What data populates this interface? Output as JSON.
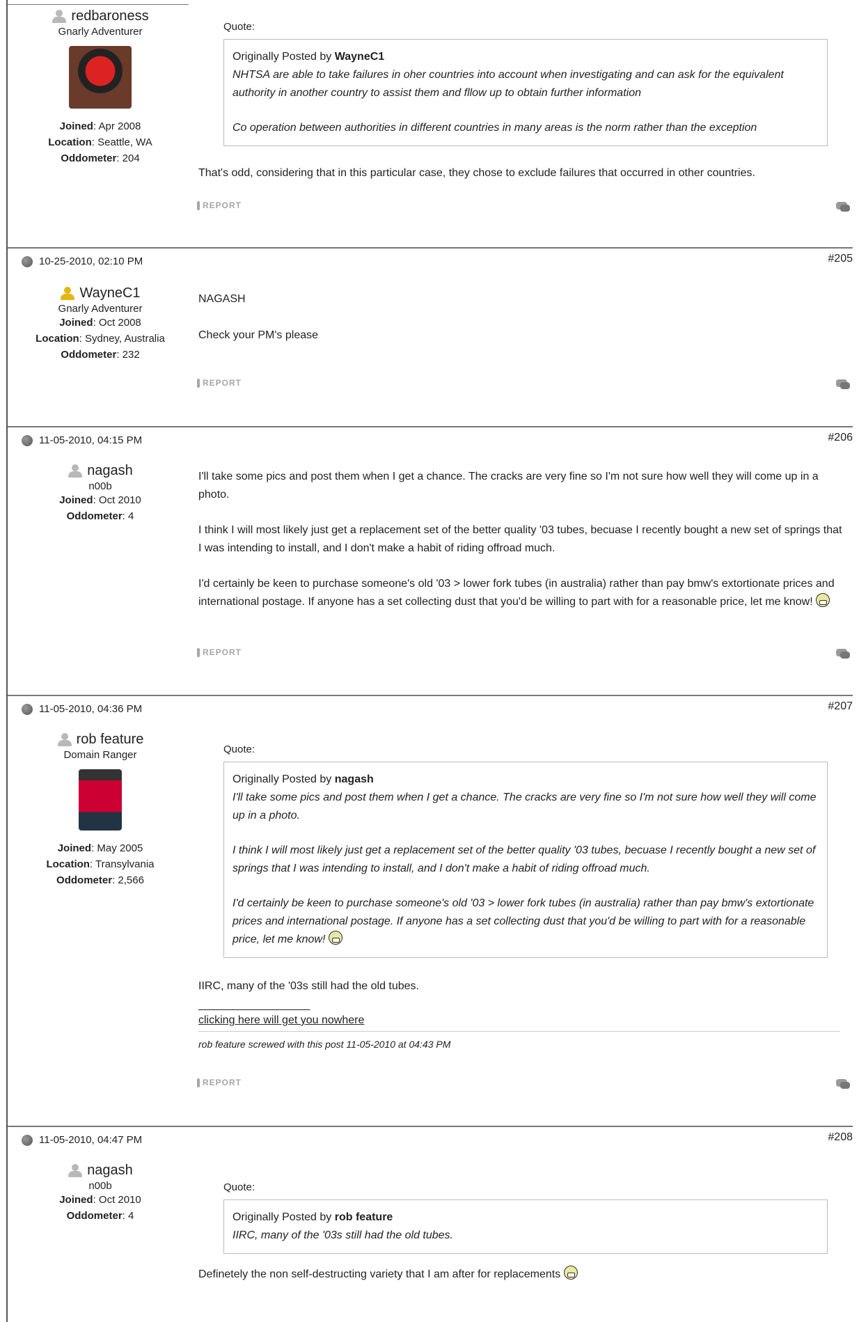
{
  "common": {
    "report_label": "REPORT",
    "quote_label": "Quote:",
    "originally_posted_by": "Originally Posted by"
  },
  "posts": [
    {
      "user": {
        "name": "redbaroness",
        "title": "Gnarly Adventurer",
        "joined_label": "Joined",
        "joined": "Apr 2008",
        "location_label": "Location",
        "location": "Seattle, WA",
        "odo_label": "Oddometer",
        "odometer": "204"
      },
      "quote": {
        "author": "WayneC1",
        "p1": "NHTSA are able to take failures in oher countries into account when investigating and can ask for the equivalent authority in another country to assist them and fllow up to obtain further information",
        "p2": "Co operation between authorities in different countries in many areas is the norm rather than the exception"
      },
      "body": [
        "That's odd, considering that in this particular case, they chose to exclude failures that occurred in other countries."
      ]
    },
    {
      "date": "10-25-2010, 02:10 PM",
      "number": "#205",
      "user": {
        "name": "WayneC1",
        "title": "Gnarly Adventurer",
        "joined_label": "Joined",
        "joined": "Oct 2008",
        "location_label": "Location",
        "location": "Sydney, Australia",
        "odo_label": "Oddometer",
        "odometer": "232"
      },
      "body": [
        "NAGASH",
        "Check your PM's please"
      ]
    },
    {
      "date": "11-05-2010, 04:15 PM",
      "number": "#206",
      "user": {
        "name": "nagash",
        "title": "n00b",
        "joined_label": "Joined",
        "joined": "Oct 2010",
        "odo_label": "Oddometer",
        "odometer": "4"
      },
      "body": [
        "I'll take some pics and post them when I get a chance. The cracks are very fine so I'm not sure how well they will come up in a photo.",
        "I think I will most likely just get a replacement set of the better quality '03 tubes, becuase I recently bought a new set of springs that I was intending to install, and I don't make a habit of riding offroad much.",
        "I'd certainly be keen to purchase someone's old '03 > lower fork tubes (in australia) rather than pay bmw's extortionate prices and international postage. If anyone has a set collecting dust that you'd be willing to part with for a reasonable price, let me know!"
      ]
    },
    {
      "date": "11-05-2010, 04:36 PM",
      "number": "#207",
      "user": {
        "name": "rob feature",
        "title": "Domain Ranger",
        "joined_label": "Joined",
        "joined": "May 2005",
        "location_label": "Location",
        "location": "Transylvania",
        "odo_label": "Oddometer",
        "odometer": "2,566"
      },
      "quote": {
        "author": "nagash",
        "p1": "I'll take some pics and post them when I get a chance. The cracks are very fine so I'm not sure how well they will come up in a photo.",
        "p2": "I think I will most likely just get a replacement set of the better quality '03 tubes, becuase I recently bought a new set of springs that I was intending to install, and I don't make a habit of riding offroad much.",
        "p3": "I'd certainly be keen to purchase someone's old '03 > lower fork tubes (in australia) rather than pay bmw's extortionate prices and international postage. If anyone has a set collecting dust that you'd be willing to part with for a reasonable price, let me know!"
      },
      "body": [
        "IIRC, many of the '03s still had the old tubes."
      ],
      "signature": {
        "line": "__________________",
        "link": "clicking here will get you nowhere"
      },
      "edit_note": "rob feature screwed with this post 11-05-2010 at 04:43 PM"
    },
    {
      "date": "11-05-2010, 04:47 PM",
      "number": "#208",
      "user": {
        "name": "nagash",
        "title": "n00b",
        "joined_label": "Joined",
        "joined": "Oct 2010",
        "odo_label": "Oddometer",
        "odometer": "4"
      },
      "quote": {
        "author": "rob feature",
        "p1": "IIRC, many of the '03s still had the old tubes."
      },
      "body": [
        "Definetely the non self-destructing variety that I am after for replacements"
      ]
    }
  ]
}
